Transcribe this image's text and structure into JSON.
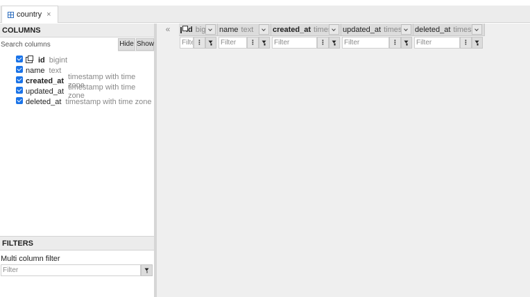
{
  "tab": {
    "label": "country",
    "close_glyph": "×",
    "icon": "table-icon"
  },
  "columns_panel": {
    "title": "COLUMNS",
    "search_placeholder": "Search columns",
    "hide_label": "Hide",
    "show_label": "Show",
    "items": [
      {
        "name": "id",
        "type": "bigint",
        "checked": true,
        "key": true,
        "bold": true
      },
      {
        "name": "name",
        "type": "text",
        "checked": true,
        "key": false,
        "bold": false
      },
      {
        "name": "created_at",
        "type": "timestamp with time zone",
        "checked": true,
        "key": false,
        "bold": true
      },
      {
        "name": "updated_at",
        "type": "timestamp with time zone",
        "checked": true,
        "key": false,
        "bold": false
      },
      {
        "name": "deleted_at",
        "type": "timestamp with time zone",
        "checked": true,
        "key": false,
        "bold": false
      }
    ]
  },
  "filters_panel": {
    "title": "FILTERS",
    "multi_label": "Multi column filter",
    "placeholder": "Filter"
  },
  "grid": {
    "collapse_glyph": "«",
    "filter_placeholder": "Filter",
    "menu_glyph": "⋮",
    "columns": [
      {
        "name": "id",
        "type": "bigint",
        "bold": true,
        "key": true
      },
      {
        "name": "name",
        "type": "text",
        "bold": false,
        "key": false
      },
      {
        "name": "created_at",
        "type": "timestamp with time zone",
        "bold": true,
        "key": false
      },
      {
        "name": "updated_at",
        "type": "timestamp with time zone",
        "bold": false,
        "key": false
      },
      {
        "name": "deleted_at",
        "type": "timestamp with time zone",
        "bold": false,
        "key": false
      }
    ]
  }
}
